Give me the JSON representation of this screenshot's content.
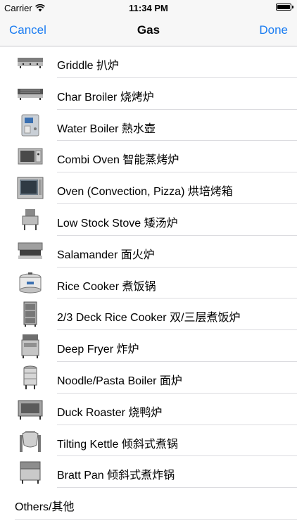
{
  "status_bar": {
    "carrier": "Carrier",
    "time": "11:34 PM"
  },
  "nav": {
    "cancel": "Cancel",
    "title": "Gas",
    "done": "Done"
  },
  "items": [
    {
      "label": "Griddle 扒炉",
      "icon": "griddle-icon"
    },
    {
      "label": "Char Broiler 烧烤炉",
      "icon": "char-broiler-icon"
    },
    {
      "label": "Water Boiler 熱水壺",
      "icon": "water-boiler-icon"
    },
    {
      "label": "Combi Oven 智能蒸烤炉",
      "icon": "combi-oven-icon"
    },
    {
      "label": "Oven (Convection, Pizza) 烘培烤箱",
      "icon": "oven-icon"
    },
    {
      "label": "Low Stock Stove 矮汤炉",
      "icon": "low-stock-stove-icon"
    },
    {
      "label": "Salamander 面火炉",
      "icon": "salamander-icon"
    },
    {
      "label": "Rice Cooker 煮饭锅",
      "icon": "rice-cooker-icon"
    },
    {
      "label": "2/3 Deck Rice Cooker  双/三层煮饭炉",
      "icon": "deck-rice-cooker-icon"
    },
    {
      "label": "Deep Fryer 炸炉",
      "icon": "deep-fryer-icon"
    },
    {
      "label": "Noodle/Pasta Boiler 面炉",
      "icon": "noodle-boiler-icon"
    },
    {
      "label": "Duck Roaster 烧鸭炉",
      "icon": "duck-roaster-icon"
    },
    {
      "label": "Tilting Kettle 倾斜式煮锅",
      "icon": "tilting-kettle-icon"
    },
    {
      "label": "Bratt Pan 倾斜式煮炸锅",
      "icon": "bratt-pan-icon"
    }
  ],
  "others_label": "Others/其他",
  "colors": {
    "accent": "#1a7cf2",
    "nav_bg": "#f7f7f7",
    "separator": "#dcdce0"
  }
}
